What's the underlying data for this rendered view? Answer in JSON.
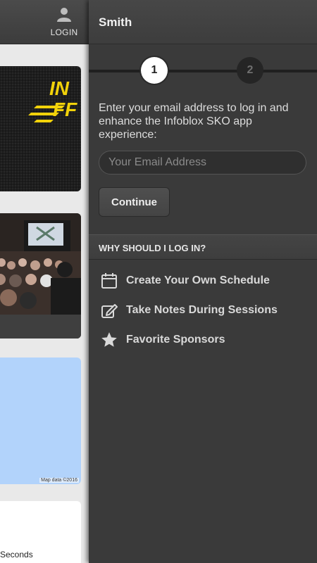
{
  "header": {
    "login_label": "LOGIN",
    "user_name": "Smith"
  },
  "background": {
    "map_credit": "Map data ©2016",
    "countdown_unit": "Seconds"
  },
  "stepper": {
    "steps": [
      "1",
      "2"
    ],
    "active_step": 1
  },
  "login": {
    "intro_text": "Enter your email address to log in and enhance the Infoblox SKO app experience:",
    "email_placeholder": "Your Email Address",
    "email_value": "",
    "continue_label": "Continue"
  },
  "why_section": {
    "title": "WHY SHOULD I LOG IN?",
    "benefits": [
      {
        "icon": "calendar-icon",
        "label": "Create Your Own Schedule"
      },
      {
        "icon": "edit-note-icon",
        "label": "Take Notes During Sessions"
      },
      {
        "icon": "star-icon",
        "label": "Favorite Sponsors"
      }
    ]
  },
  "colors": {
    "drawer_bg": "#3a3a3a",
    "header_bg": "#444444",
    "text": "#dddddd",
    "active_step": "#ffffff",
    "inactive_step": "#252525"
  }
}
